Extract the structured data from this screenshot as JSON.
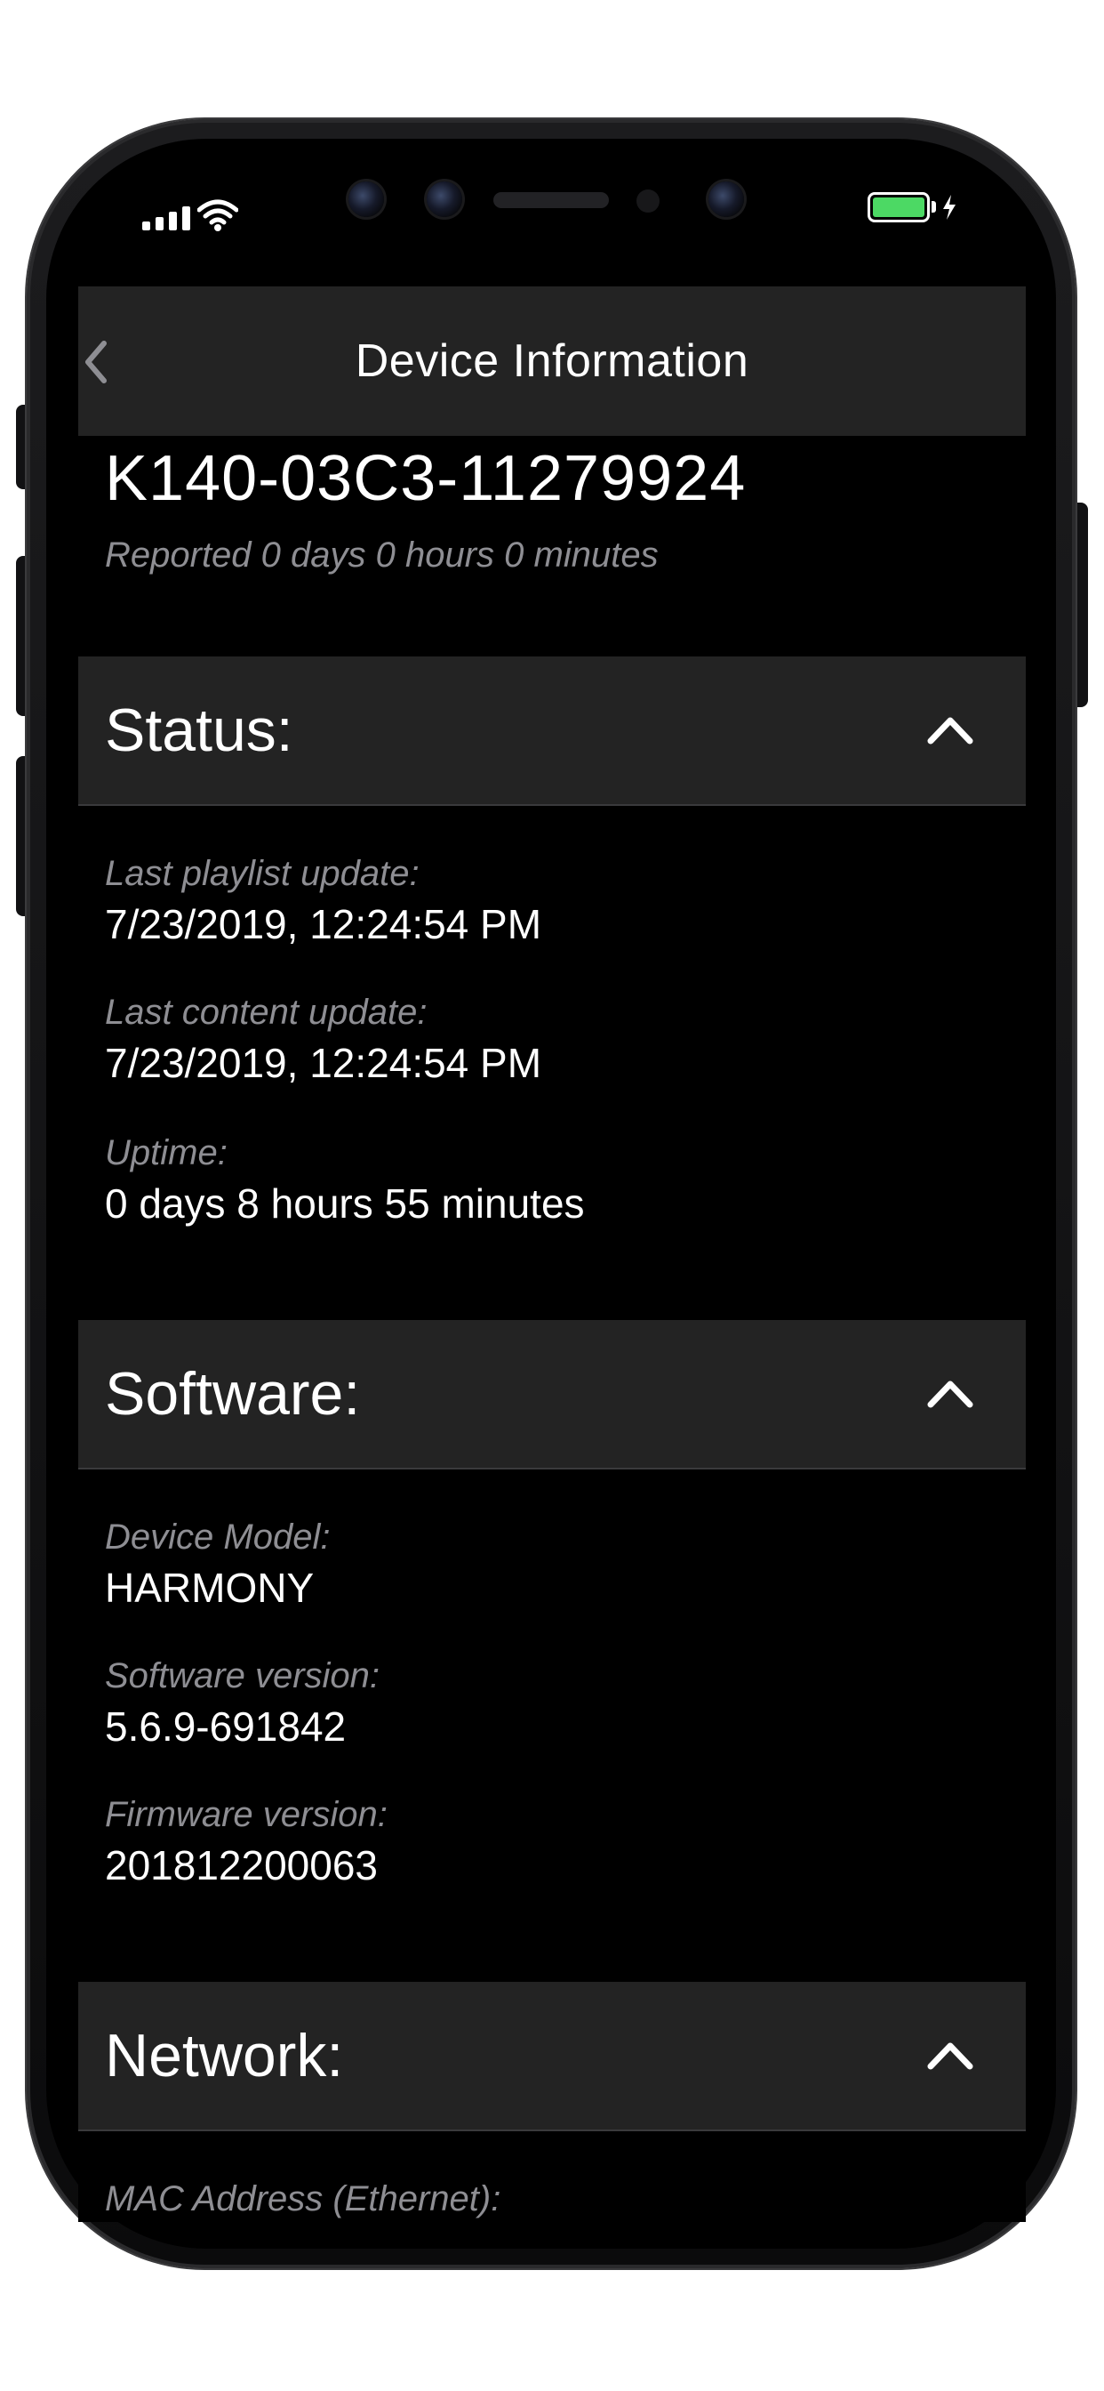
{
  "app": {
    "title": "Device Information"
  },
  "device": {
    "id": "K140-03C3-11279924",
    "reported": "Reported 0 days 0 hours 0 minutes"
  },
  "status": {
    "title": "Status:",
    "fields": [
      {
        "label": "Last playlist update:",
        "value": "7/23/2019, 12:24:54 PM"
      },
      {
        "label": "Last content update:",
        "value": "7/23/2019, 12:24:54 PM"
      },
      {
        "label": "Uptime:",
        "value": "0 days 8 hours 55 minutes"
      }
    ]
  },
  "software": {
    "title": "Software:",
    "fields": [
      {
        "label": "Device Model:",
        "value": "HARMONY"
      },
      {
        "label": "Software version:",
        "value": "5.6.9-691842"
      },
      {
        "label": "Firmware version:",
        "value": "201812200063"
      }
    ]
  },
  "network": {
    "title": "Network:",
    "fields": [
      {
        "label": "MAC Address (Ethernet):"
      }
    ]
  },
  "icons": {
    "back": "chevron-left-icon",
    "collapse": "chevron-up-icon",
    "signal": "cellular-signal-icon",
    "wifi": "wifi-icon",
    "battery": "battery-charging-icon"
  },
  "colors": {
    "background": "#000000",
    "header": "#232323",
    "label": "#8e8e93",
    "text": "#ffffff",
    "battery": "#4cd964"
  }
}
